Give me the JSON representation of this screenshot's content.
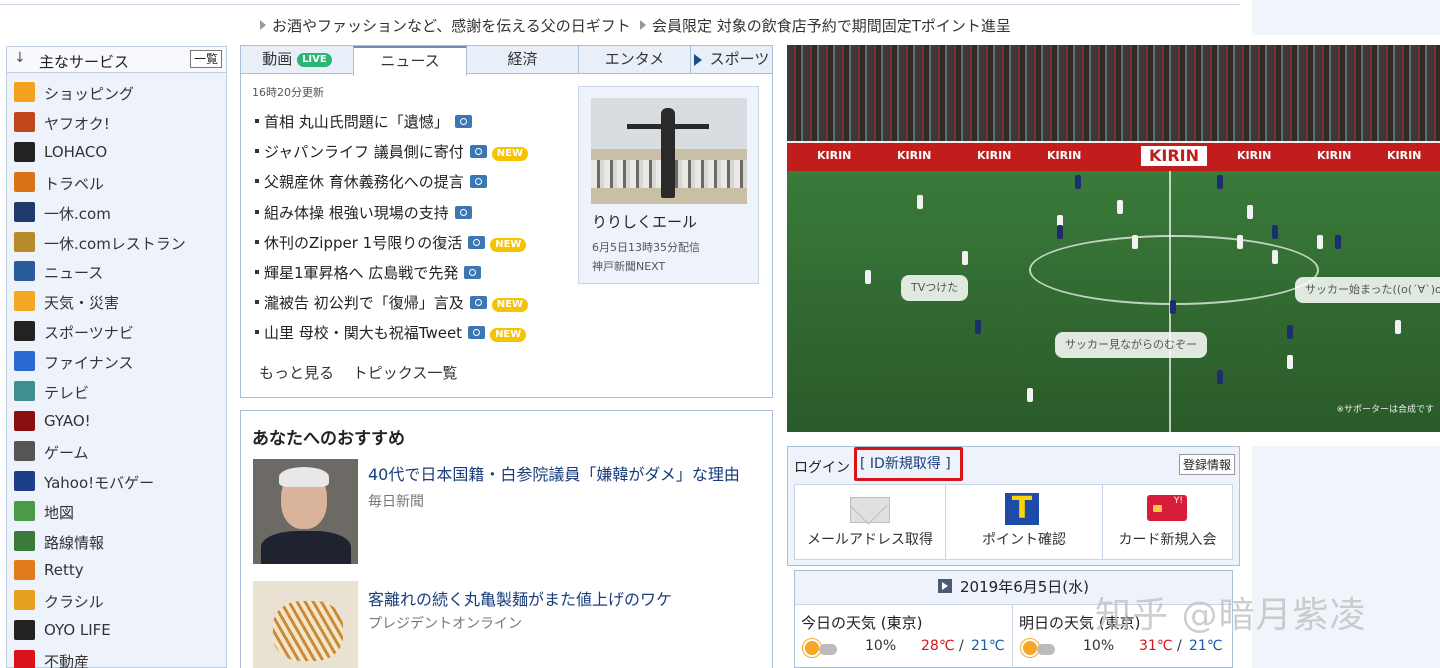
{
  "promos": [
    "お酒やファッションなど、感謝を伝える父の日ギフト",
    "会員限定 対象の飲食店予約で期間固定Tポイント進呈"
  ],
  "sidebar": {
    "title": "主なサービス",
    "all_button": "一覧",
    "items": [
      {
        "label": "ショッピング",
        "icon": "cart-icon",
        "color": "#f2a31b"
      },
      {
        "label": "ヤフオク!",
        "icon": "gavel-icon",
        "color": "#c0461b"
      },
      {
        "label": "LOHACO",
        "icon": "lohaco-icon",
        "color": "#222222"
      },
      {
        "label": "トラベル",
        "icon": "suitcase-icon",
        "color": "#d9731a"
      },
      {
        "label": "一休.com",
        "icon": "ikyu-icon",
        "color": "#1f3a6b"
      },
      {
        "label": "一休.comレストラン",
        "icon": "ikyu-restaurant-icon",
        "color": "#b78a2a"
      },
      {
        "label": "ニュース",
        "icon": "news-icon",
        "color": "#2a5a9a"
      },
      {
        "label": "天気・災害",
        "icon": "weather-icon",
        "color": "#f5a623"
      },
      {
        "label": "スポーツナビ",
        "icon": "sportsnavi-icon",
        "color": "#222222"
      },
      {
        "label": "ファイナンス",
        "icon": "chart-icon",
        "color": "#2a6ad1"
      },
      {
        "label": "テレビ",
        "icon": "tv-icon",
        "color": "#3f8f8f"
      },
      {
        "label": "GYAO!",
        "icon": "gyao-icon",
        "color": "#8a1010"
      },
      {
        "label": "ゲーム",
        "icon": "gamepad-icon",
        "color": "#555555"
      },
      {
        "label": "Yahoo!モバゲー",
        "icon": "mobage-icon",
        "color": "#1e3e8a"
      },
      {
        "label": "地図",
        "icon": "map-icon",
        "color": "#4a9a4a"
      },
      {
        "label": "路線情報",
        "icon": "train-icon",
        "color": "#3a7a3a"
      },
      {
        "label": "Retty",
        "icon": "retty-icon",
        "color": "#e07b1a"
      },
      {
        "label": "クラシル",
        "icon": "kurashiru-icon",
        "color": "#e8a020"
      },
      {
        "label": "OYO LIFE",
        "icon": "oyo-icon",
        "color": "#222222"
      },
      {
        "label": "不動産",
        "icon": "house-icon",
        "color": "#d8131b"
      }
    ]
  },
  "news": {
    "tabs": [
      {
        "label": "動画",
        "badge": "LIVE"
      },
      {
        "label": "ニュース"
      },
      {
        "label": "経済"
      },
      {
        "label": "エンタメ"
      },
      {
        "label": "スポーツ"
      }
    ],
    "updated": "16時20分更新",
    "headlines": [
      {
        "text": "首相 丸山氏問題に「遺憾」",
        "photo": true,
        "new": false
      },
      {
        "text": "ジャパンライフ 議員側に寄付",
        "photo": true,
        "new": true
      },
      {
        "text": "父親産休 育休義務化への提言",
        "photo": true,
        "new": false
      },
      {
        "text": "組み体操 根強い現場の支持",
        "photo": true,
        "new": false
      },
      {
        "text": "休刊のZipper 1号限りの復活",
        "photo": true,
        "new": true
      },
      {
        "text": "輝星1軍昇格へ 広島戦で先発",
        "photo": true,
        "new": false
      },
      {
        "text": "瀧被告 初公判で「復帰」言及",
        "photo": true,
        "new": true
      },
      {
        "text": "山里 母校・関大も祝福Tweet",
        "photo": true,
        "new": true
      }
    ],
    "new_badge": "NEW",
    "footer": [
      "もっと見る",
      "トピックス一覧"
    ],
    "pickup": {
      "title": "りりしくエール",
      "date": "6月5日13時35分配信",
      "source": "神戸新聞NEXT"
    }
  },
  "recommend": {
    "title": "あなたへのおすすめ",
    "items": [
      {
        "headline": "40代で日本国籍・白参院議員「嫌韓がダメ」な理由",
        "source": "毎日新聞"
      },
      {
        "headline": "客離れの続く丸亀製麺がまた値上げのワケ",
        "source": "プレジデントオンライン"
      }
    ]
  },
  "video": {
    "brand": "KIRIN",
    "bubbles": [
      "TVつけた",
      "サッカー始まった((o(´∀`)o))",
      "サッカー見ながらのむぞー"
    ],
    "note": "※サポーターは合成です"
  },
  "login": {
    "label": "ログイン",
    "new_id": "[ ID新規取得 ]",
    "registration": "登録情報",
    "actions": [
      {
        "label": "メールアドレス取得",
        "icon": "mail-icon"
      },
      {
        "label": "ポイント確認",
        "icon": "tpoint-icon"
      },
      {
        "label": "カード新規入会",
        "icon": "credit-card-icon"
      }
    ]
  },
  "weather": {
    "date": "2019年6月5日(水)",
    "days": [
      {
        "title": "今日の天気 (東京)",
        "rain": "10%",
        "high": "28℃",
        "low": "21℃"
      },
      {
        "title": "明日の天気 (東京)",
        "rain": "10%",
        "high": "31℃",
        "low": "21℃"
      }
    ]
  },
  "watermark": "知乎 @暗月紫凌"
}
